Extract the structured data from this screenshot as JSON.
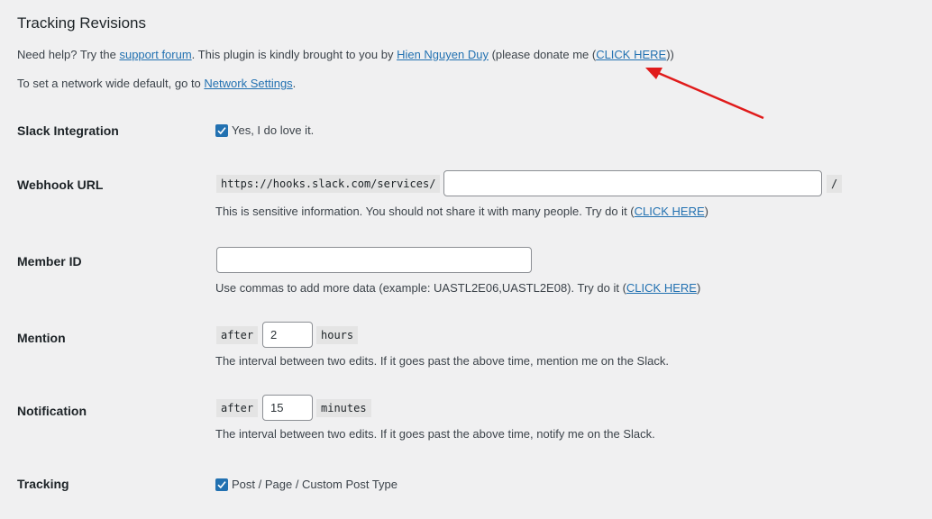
{
  "header": {
    "title": "Tracking Revisions"
  },
  "help": {
    "prefix": "Need help? Try the ",
    "support_link": "support forum",
    "middle": ". This plugin is kindly brought to you by ",
    "author_link": "Hien Nguyen Duy",
    "donate_prefix": " (please donate me (",
    "donate_link": "CLICK HERE",
    "donate_suffix": "))"
  },
  "network": {
    "prefix": "To set a network wide default, go to ",
    "link": "Network Settings",
    "suffix": "."
  },
  "slack": {
    "label": "Slack Integration",
    "checked": true,
    "checkbox_label": "Yes, I do love it."
  },
  "webhook": {
    "label": "Webhook URL",
    "prefix": "https://hooks.slack.com/services/",
    "value": "",
    "suffix": "/",
    "desc_prefix": "This is sensitive information. You should not share it with many people. Try do it (",
    "desc_link": "CLICK HERE",
    "desc_suffix": ")"
  },
  "member": {
    "label": "Member ID",
    "value": "",
    "desc_prefix": "Use commas to add more data (example: UASTL2E06,UASTL2E08). Try do it (",
    "desc_link": "CLICK HERE",
    "desc_suffix": ")"
  },
  "mention": {
    "label": "Mention",
    "before": "after",
    "value": "2",
    "unit": "hours",
    "desc": "The interval between two edits. If it goes past the above time, mention me on the Slack."
  },
  "notification": {
    "label": "Notification",
    "before": "after",
    "value": "15",
    "unit": "minutes",
    "desc": "The interval between two edits. If it goes past the above time, notify me on the Slack."
  },
  "tracking": {
    "label": "Tracking",
    "checked": true,
    "checkbox_label": "Post / Page / Custom Post Type"
  },
  "colors": {
    "link": "#2271b1",
    "checkbox": "#2271b1",
    "annotation_arrow": "#e01b1b"
  }
}
